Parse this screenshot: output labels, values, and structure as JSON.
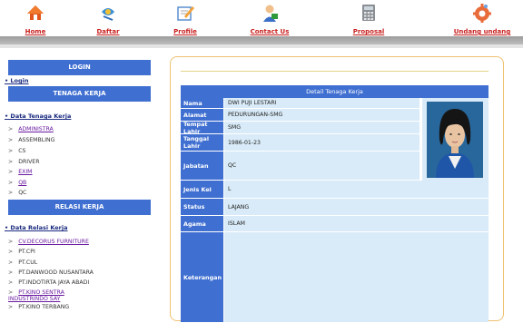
{
  "nav": [
    {
      "label": "Home",
      "icon": "home-icon"
    },
    {
      "label": "Daftar",
      "icon": "daftar-icon"
    },
    {
      "label": "Profile",
      "icon": "profile-icon"
    },
    {
      "label": "Contact Us",
      "icon": "contact-icon"
    },
    {
      "label": "Proposal",
      "icon": "calculator-icon"
    },
    {
      "label": "Undang undang",
      "icon": "gear-icon"
    }
  ],
  "sidebar": {
    "login_header": "LOGIN",
    "login_link": "• Login",
    "tenaga_header": "TENAGA KERJA",
    "data_tenaga_link": "• Data Tenaga Kerja",
    "tenaga_items": [
      {
        "label": "ADMINISTRA",
        "link": true
      },
      {
        "label": "ASSEMBLING",
        "link": false
      },
      {
        "label": "CS",
        "link": false
      },
      {
        "label": "DRIVER",
        "link": false
      },
      {
        "label": "EXIM",
        "link": true
      },
      {
        "label": "QB",
        "link": true
      },
      {
        "label": "QC",
        "link": false
      }
    ],
    "relasi_header": "RELASI KERJA",
    "data_relasi_link": "• Data Relasi Kerja",
    "relasi_items": [
      {
        "label": "CV.DECORUS FURNITURE",
        "link": true
      },
      {
        "label": "PT.CPI",
        "link": false
      },
      {
        "label": "PT.CUL",
        "link": false
      },
      {
        "label": "PT.DANWOOD NUSANTARA",
        "link": false
      },
      {
        "label": "PT.INDOTIRTA JAYA ABADI",
        "link": false
      },
      {
        "label": "PT.KINO SENTRA",
        "link": true
      },
      {
        "label": "INDUSTRINDO SAY",
        "link": true
      },
      {
        "label": "PT.KINO TERBANG",
        "link": false
      }
    ]
  },
  "detail": {
    "title": "Detail Tenaga Kerja",
    "fields": [
      {
        "label": "Nama",
        "value": "DWI PUJI LESTARI"
      },
      {
        "label": "Alamat",
        "value": "PEDURUNGAN-SMG"
      },
      {
        "label": "Tempat Lahir",
        "value": "SMG"
      },
      {
        "label": "Tanggal Lahir",
        "value": "1986-01-23"
      },
      {
        "label": "Jabatan",
        "value": "QC"
      },
      {
        "label": "Jenis Kel",
        "value": "L"
      },
      {
        "label": "Status",
        "value": "LAJANG"
      },
      {
        "label": "Agama",
        "value": "ISLAM"
      },
      {
        "label": "Keterangan",
        "value": ""
      }
    ]
  },
  "colors": {
    "accent": "#3f6fd1",
    "nav_text": "#c8201e",
    "cell_bg": "#d9ebf8",
    "panel_border": "#f0c070"
  }
}
